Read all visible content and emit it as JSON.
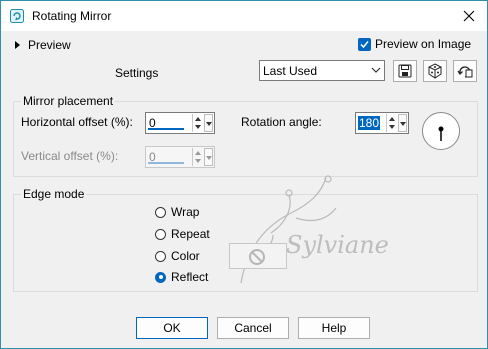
{
  "window": {
    "title": "Rotating Mirror"
  },
  "preview": {
    "toggle_label": "Preview",
    "preview_on_image_label": "Preview on Image",
    "preview_on_image_checked": true
  },
  "settings": {
    "label": "Settings",
    "preset_value": "Last Used"
  },
  "mirror_placement": {
    "title": "Mirror placement",
    "horizontal_offset_label": "Horizontal offset (%):",
    "horizontal_offset_value": "0",
    "vertical_offset_label": "Vertical offset (%):",
    "vertical_offset_value": "0",
    "vertical_offset_enabled": false,
    "rotation_angle_label": "Rotation angle:",
    "rotation_angle_value": "180"
  },
  "edge_mode": {
    "title": "Edge mode",
    "options": [
      {
        "label": "Wrap",
        "selected": false
      },
      {
        "label": "Repeat",
        "selected": false
      },
      {
        "label": "Color",
        "selected": false
      },
      {
        "label": "Reflect",
        "selected": true
      }
    ]
  },
  "watermark": {
    "text": "Sylviane"
  },
  "buttons": {
    "ok": "OK",
    "cancel": "Cancel",
    "help": "Help"
  },
  "colors": {
    "accent": "#0067c0",
    "window_border": "#2f8fa8",
    "dialog_bg": "#f0f0f0"
  }
}
